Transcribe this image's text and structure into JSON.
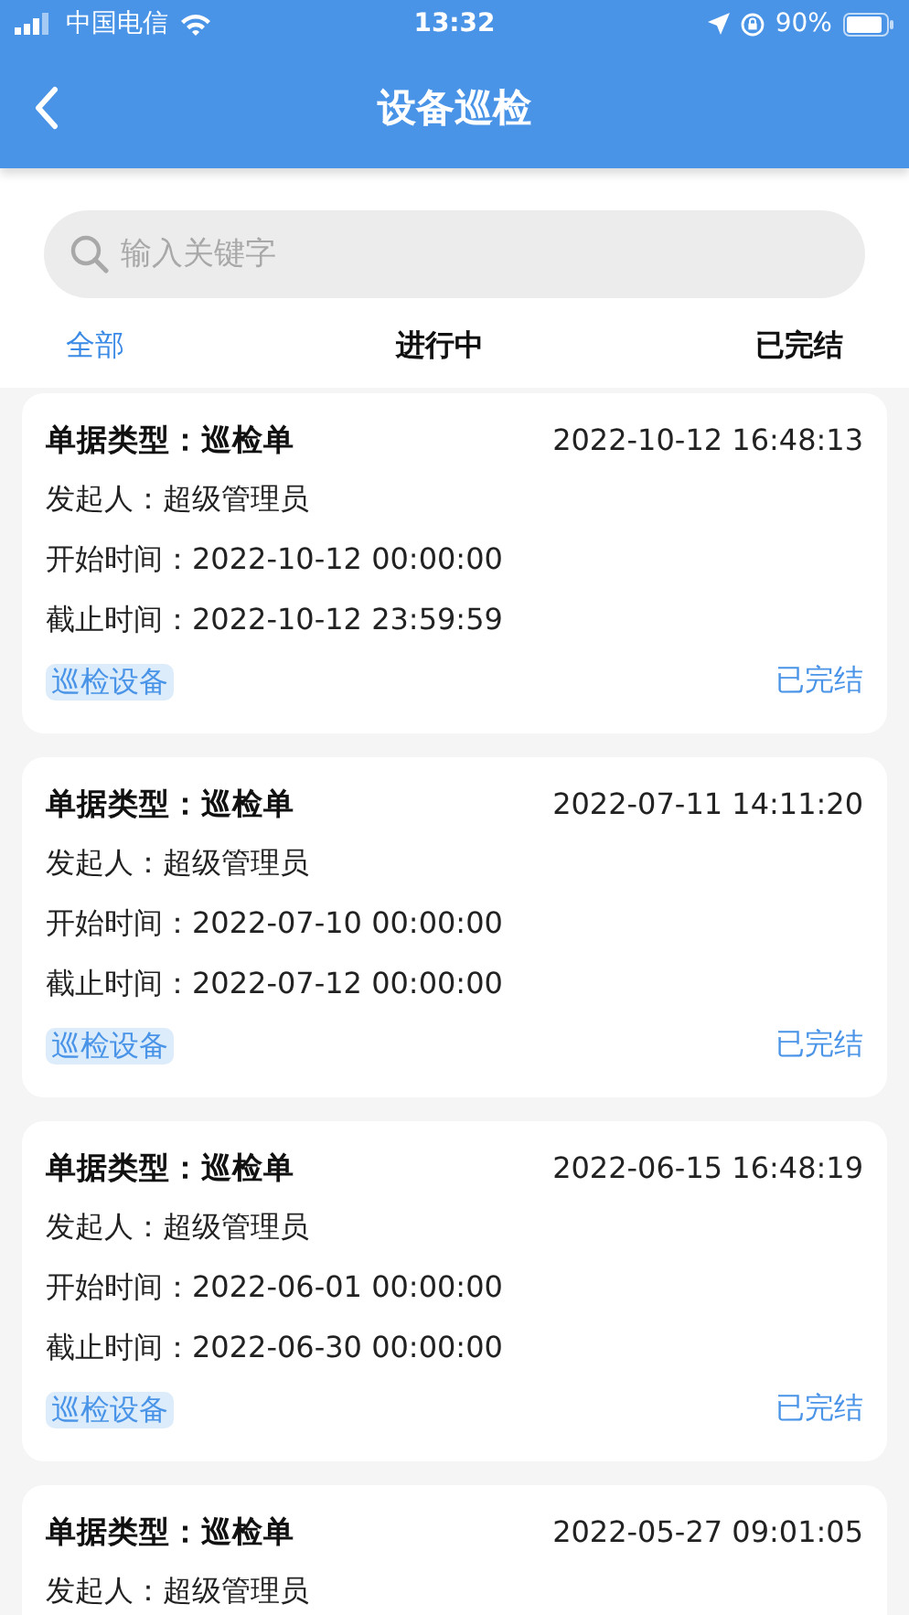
{
  "status_bar": {
    "carrier": "中国电信",
    "time": "13:32",
    "battery": "90%"
  },
  "header": {
    "title": "设备巡检"
  },
  "search": {
    "placeholder": "输入关键字"
  },
  "tabs": [
    {
      "label": "全部",
      "selected": true
    },
    {
      "label": "进行中",
      "selected": false
    },
    {
      "label": "已完结",
      "selected": false
    }
  ],
  "cards": [
    {
      "type": "单据类型：巡检单",
      "created": "2022-10-12 16:48:13",
      "initiator": "发起人：超级管理员",
      "start": "开始时间：2022-10-12 00:00:00",
      "end": "截止时间：2022-10-12 23:59:59",
      "tag": "巡检设备",
      "status": "已完结"
    },
    {
      "type": "单据类型：巡检单",
      "created": "2022-07-11 14:11:20",
      "initiator": "发起人：超级管理员",
      "start": "开始时间：2022-07-10 00:00:00",
      "end": "截止时间：2022-07-12 00:00:00",
      "tag": "巡检设备",
      "status": "已完结"
    },
    {
      "type": "单据类型：巡检单",
      "created": "2022-06-15 16:48:19",
      "initiator": "发起人：超级管理员",
      "start": "开始时间：2022-06-01 00:00:00",
      "end": "截止时间：2022-06-30 00:00:00",
      "tag": "巡检设备",
      "status": "已完结"
    },
    {
      "type": "单据类型：巡检单",
      "created": "2022-05-27 09:01:05",
      "initiator": "发起人：超级管理员"
    }
  ]
}
